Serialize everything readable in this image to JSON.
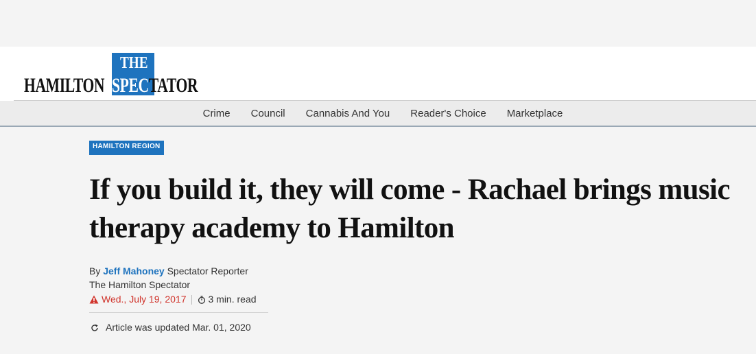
{
  "masthead": {
    "logo_the": "THE",
    "logo_hamilton": "HAMILTON",
    "logo_spectator_spec": "SPEC",
    "logo_spectator_rest": "TATOR",
    "brand_color": "#1e73be"
  },
  "nav": {
    "items": [
      {
        "label": "Crime"
      },
      {
        "label": "Council"
      },
      {
        "label": "Cannabis And You"
      },
      {
        "label": "Reader's Choice"
      },
      {
        "label": "Marketplace"
      }
    ]
  },
  "article": {
    "section": "HAMILTON REGION",
    "headline": "If you build it, they will come - Rachael brings music therapy academy to Hamilton",
    "byline_prefix": "By",
    "author": "Jeff Mahoney",
    "author_role": "Spectator Reporter",
    "publication": "The Hamilton Spectator",
    "date": "Wed., July 19, 2017",
    "read_time": "3 min. read",
    "updated": "Article was updated Mar. 01, 2020",
    "icons": {
      "date": "alert-triangle-icon",
      "read_time": "timer-icon",
      "updated": "refresh-icon"
    },
    "colors": {
      "date": "#d0342c",
      "author": "#1e73be"
    }
  }
}
